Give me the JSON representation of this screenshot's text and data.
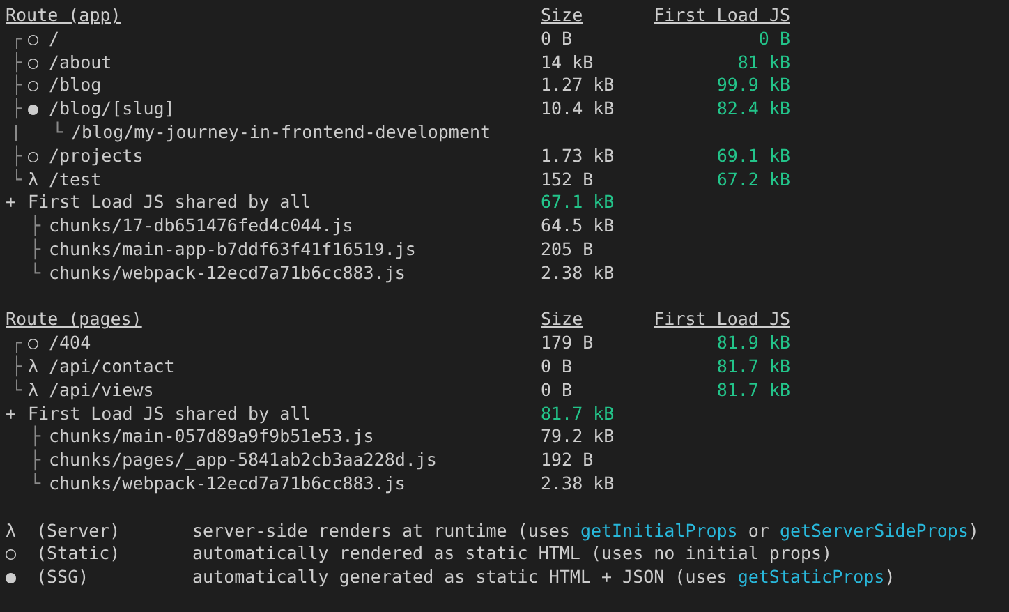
{
  "sections": [
    {
      "header": {
        "route": "Route (app)",
        "size": "Size",
        "first_load": "First Load JS"
      },
      "routes": [
        {
          "branch": "┌",
          "symbol": "○",
          "path": "/",
          "size": "0 B",
          "first_load": "0 B"
        },
        {
          "branch": "├",
          "symbol": "○",
          "path": "/about",
          "size": "14 kB",
          "first_load": "81 kB"
        },
        {
          "branch": "├",
          "symbol": "○",
          "path": "/blog",
          "size": "1.27 kB",
          "first_load": "99.9 kB"
        },
        {
          "branch": "├",
          "symbol": "●",
          "path": "/blog/[slug]",
          "size": "10.4 kB",
          "first_load": "82.4 kB",
          "children": [
            {
              "branch": "└",
              "path": "/blog/my-journey-in-frontend-development"
            }
          ]
        },
        {
          "branch": "├",
          "symbol": "○",
          "path": "/projects",
          "size": "1.73 kB",
          "first_load": "69.1 kB"
        },
        {
          "branch": "└",
          "symbol": "λ",
          "path": "/test",
          "size": "152 B",
          "first_load": "67.2 kB"
        }
      ],
      "shared": {
        "marker": "+",
        "label": "First Load JS shared by all",
        "size": "67.1 kB",
        "chunks": [
          {
            "branch": "├",
            "name": "chunks/17-db651476fed4c044.js",
            "size": "64.5 kB"
          },
          {
            "branch": "├",
            "name": "chunks/main-app-b7ddf63f41f16519.js",
            "size": "205 B"
          },
          {
            "branch": "└",
            "name": "chunks/webpack-12ecd7a71b6cc883.js",
            "size": "2.38 kB"
          }
        ]
      }
    },
    {
      "header": {
        "route": "Route (pages)",
        "size": "Size",
        "first_load": "First Load JS"
      },
      "routes": [
        {
          "branch": "┌",
          "symbol": "○",
          "path": "/404",
          "size": "179 B",
          "first_load": "81.9 kB"
        },
        {
          "branch": "├",
          "symbol": "λ",
          "path": "/api/contact",
          "size": "0 B",
          "first_load": "81.7 kB"
        },
        {
          "branch": "└",
          "symbol": "λ",
          "path": "/api/views",
          "size": "0 B",
          "first_load": "81.7 kB"
        }
      ],
      "shared": {
        "marker": "+",
        "label": "First Load JS shared by all",
        "size": "81.7 kB",
        "chunks": [
          {
            "branch": "├",
            "name": "chunks/main-057d89a9f9b51e53.js",
            "size": "79.2 kB"
          },
          {
            "branch": "├",
            "name": "chunks/pages/_app-5841ab2cb3aa228d.js",
            "size": "192 B"
          },
          {
            "branch": "└",
            "name": "chunks/webpack-12ecd7a71b6cc883.js",
            "size": "2.38 kB"
          }
        ]
      }
    }
  ],
  "legend": [
    {
      "symbol": "λ",
      "type": "(Server)",
      "description": [
        {
          "kind": "text",
          "text": "server-side renders at runtime (uses "
        },
        {
          "kind": "code",
          "text": "getInitialProps"
        },
        {
          "kind": "text",
          "text": " or "
        },
        {
          "kind": "code",
          "text": "getServerSideProps"
        },
        {
          "kind": "text",
          "text": ")"
        }
      ]
    },
    {
      "symbol": "○",
      "type": "(Static)",
      "description": [
        {
          "kind": "text",
          "text": "automatically rendered as static HTML (uses no initial props)"
        }
      ]
    },
    {
      "symbol": "●",
      "type": "(SSG)",
      "description": [
        {
          "kind": "text",
          "text": "automatically generated as static HTML + JSON (uses "
        },
        {
          "kind": "code",
          "text": "getStaticProps"
        },
        {
          "kind": "text",
          "text": ")"
        }
      ]
    }
  ]
}
